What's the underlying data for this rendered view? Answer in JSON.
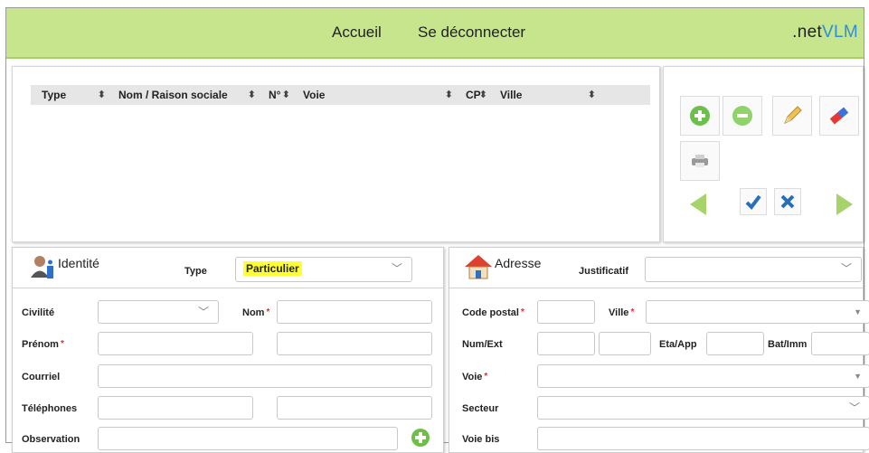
{
  "header": {
    "nav": {
      "home": "Accueil",
      "logout": "Se déconnecter"
    },
    "logo": {
      "part1": ".net",
      "part2": "VLM"
    }
  },
  "grid": {
    "columns": [
      "Type",
      "Nom / Raison sociale",
      "N°",
      "Voie",
      "CP",
      "Ville"
    ],
    "rows": []
  },
  "toolbar": {
    "buttons": [
      "add-icon",
      "remove-icon",
      "pencil-icon",
      "eraser-icon",
      "print-icon",
      "previous-arrow-icon",
      "checkmark-icon",
      "cancel-x-icon",
      "next-arrow-icon"
    ]
  },
  "identite": {
    "title": "Identité",
    "type_label": "Type",
    "type_value": "Particulier",
    "civilite_label": "Civilité",
    "civilite_value": "",
    "nom_label": "Nom",
    "prenom_label": "Prénom",
    "courriel_label": "Courriel",
    "telephones_label": "Téléphones",
    "observation_label": "Observation",
    "required_mark": "*"
  },
  "adresse": {
    "title": "Adresse",
    "justificatif_label": "Justificatif",
    "justificatif_value": "",
    "code_postal_label": "Code postal",
    "ville_label": "Ville",
    "num_ext_label": "Num/Ext",
    "eta_app_label": "Eta/App",
    "bat_imm_label": "Bat/Imm",
    "voie_label": "Voie",
    "secteur_label": "Secteur",
    "voie_bis_label": "Voie bis",
    "required_mark": "*"
  },
  "colors": {
    "topbar": "#c6e58c",
    "logo_accent": "#2e8fd6",
    "add_green": "#6cc04a",
    "required_red": "#e03030",
    "highlight": "#ffff33"
  }
}
